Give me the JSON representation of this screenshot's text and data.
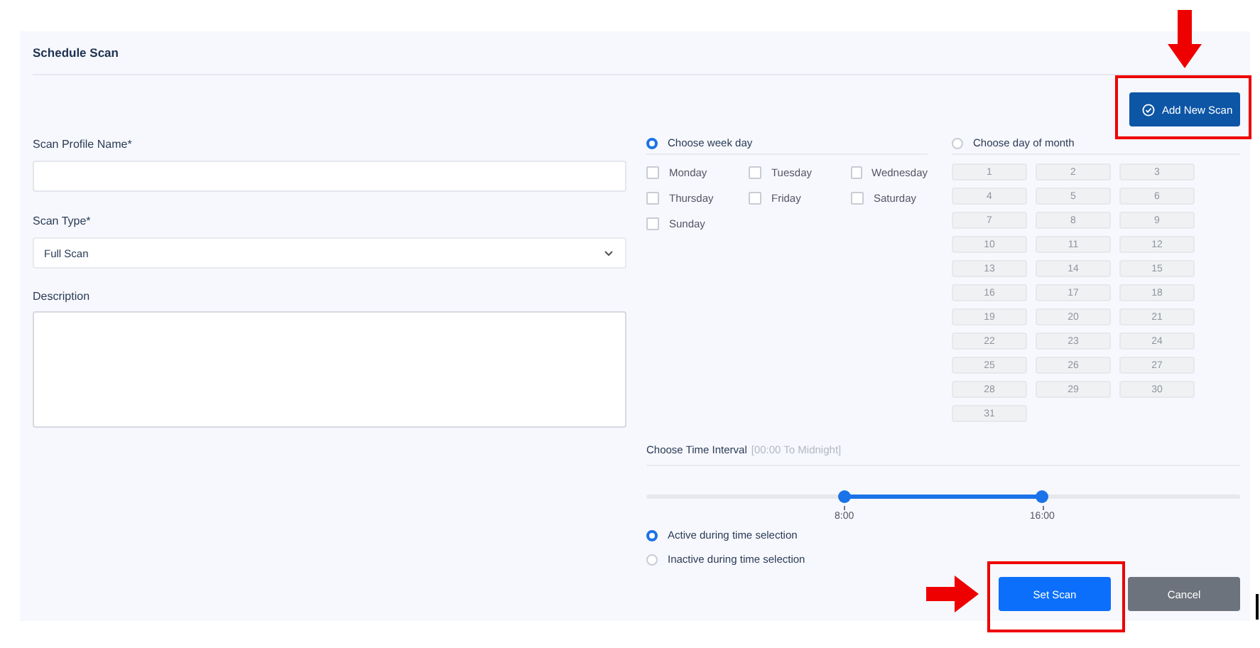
{
  "title": "Schedule Scan",
  "add_button": {
    "label": "Add New Scan"
  },
  "fields": [
    {
      "kind": "text",
      "label": "Scan Profile Name*"
    },
    {
      "kind": "select",
      "label": "Scan Type*",
      "value": "Full Scan"
    },
    {
      "kind": "textarea",
      "label": "Description"
    }
  ],
  "schedule_modes": [
    {
      "label": "Choose week day",
      "selected": true
    },
    {
      "label": "Choose day of month",
      "selected": false
    }
  ],
  "week_days": [
    {
      "label": "Monday",
      "checked": false
    },
    {
      "label": "Tuesday",
      "checked": false
    },
    {
      "label": "Wednesday",
      "checked": false
    },
    {
      "label": "Thursday",
      "checked": false
    },
    {
      "label": "Friday",
      "checked": false
    },
    {
      "label": "Saturday",
      "checked": false
    },
    {
      "label": "Sunday",
      "checked": false
    }
  ],
  "month_days": {
    "disabled": true,
    "days": [
      "1",
      "2",
      "3",
      "4",
      "5",
      "6",
      "7",
      "8",
      "9",
      "10",
      "11",
      "12",
      "13",
      "14",
      "15",
      "16",
      "17",
      "18",
      "19",
      "20",
      "21",
      "22",
      "23",
      "24",
      "25",
      "26",
      "27",
      "28",
      "29",
      "30",
      "31"
    ]
  },
  "time_interval": {
    "label": "Choose Time Interval",
    "hint": "[00:00 To Midnight]",
    "handles": [
      {
        "level": 0.3333,
        "label": "8:00"
      },
      {
        "level": 0.6667,
        "label": "16:00"
      }
    ]
  },
  "activity_modes": [
    {
      "label": "Active during time selection",
      "selected": true
    },
    {
      "label": "Inactive during time selection",
      "selected": false
    }
  ],
  "buttons": [
    {
      "kind": "primary",
      "label": "Set Scan"
    },
    {
      "kind": "secondary",
      "label": "Cancel"
    }
  ]
}
